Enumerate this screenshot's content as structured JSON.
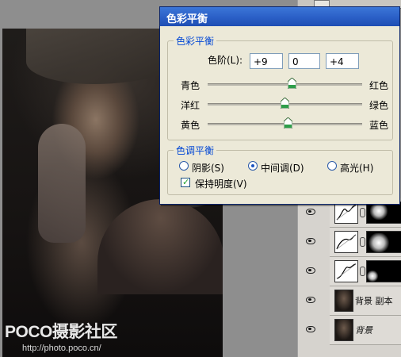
{
  "dialog": {
    "title": "色彩平衡",
    "color_balance_group": "色彩平衡",
    "levels_label": "色阶(L):",
    "levels": [
      "+9",
      "0",
      "+4"
    ],
    "sliders": [
      {
        "left": "青色",
        "right": "红色",
        "value": 9
      },
      {
        "left": "洋红",
        "right": "绿色",
        "value": 0
      },
      {
        "left": "黄色",
        "right": "蓝色",
        "value": 4
      }
    ],
    "tone_group": "色调平衡",
    "tones": [
      "阴影(S)",
      "中间调(D)",
      "高光(H)"
    ],
    "selected_tone": "中间调(D)",
    "preserve_luminosity": "保持明度(V)",
    "preserve_checked": true
  },
  "layers": {
    "names": [
      "背景 副本",
      "背景"
    ]
  },
  "watermark": {
    "logo": "POCO摄影社区",
    "url": "http://photo.poco.cn/"
  },
  "colors": {
    "title_blue": "#2a5fc6",
    "group_label": "#0046d5",
    "dialog_bg": "#ece9d8",
    "slider_green": "#2e9e4a"
  }
}
